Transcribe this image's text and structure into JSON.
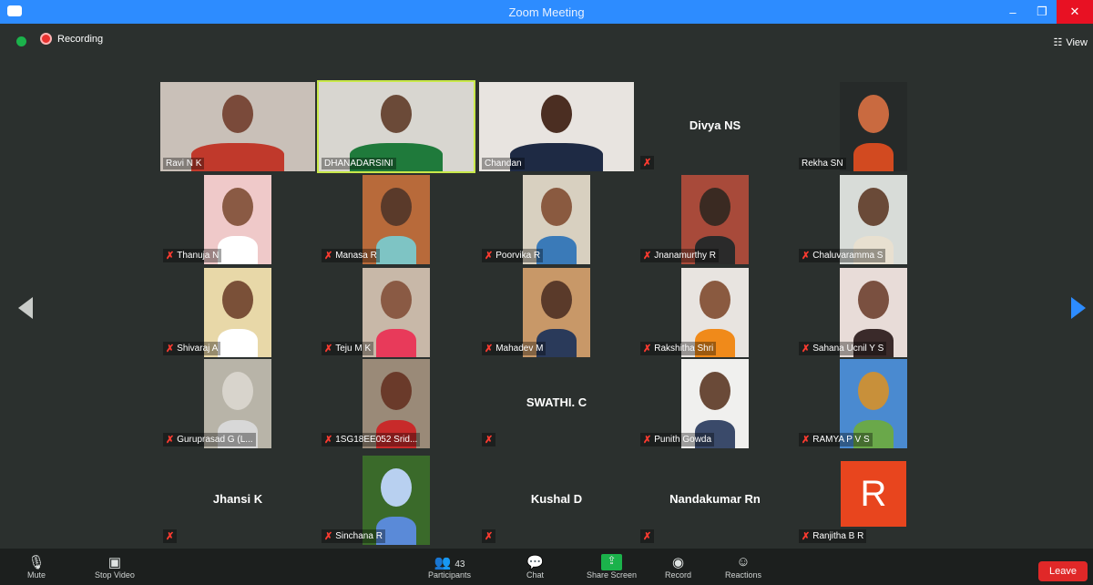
{
  "window": {
    "title": "Zoom Meeting"
  },
  "meeting": {
    "recording_label": "Recording",
    "view_label": "View"
  },
  "participants": [
    {
      "name": "Ravi N K",
      "display": "video",
      "muted": false,
      "bg": "#c9c0b8",
      "skin": "#7a4a3a",
      "shirt": "#c0392b"
    },
    {
      "name": "DHANADARSINI",
      "display": "video",
      "muted": false,
      "bg": "#d8d6d0",
      "skin": "#6b4a38",
      "shirt": "#1f7a3b",
      "active": true
    },
    {
      "name": "Chandan",
      "display": "video",
      "muted": false,
      "bg": "#e8e4e0",
      "skin": "#4b2e22",
      "shirt": "#1e2a44"
    },
    {
      "name": "Divya NS",
      "display": "name",
      "muted": true
    },
    {
      "name": "Rekha SN",
      "display": "video",
      "muted": false,
      "bg": "#262a29",
      "skin": "#c96a40",
      "shirt": "#d24a20"
    },
    {
      "name": "Thanuja N",
      "display": "video",
      "muted": true,
      "bg": "#efc9c9",
      "skin": "#8a5a44",
      "shirt": "#ffffff"
    },
    {
      "name": "Manasa R",
      "display": "video",
      "muted": true,
      "bg": "#b86a3a",
      "skin": "#5a3a2a",
      "shirt": "#7ec4c4"
    },
    {
      "name": "Poorvika R",
      "display": "video",
      "muted": true,
      "bg": "#d8d0c0",
      "skin": "#8a5a40",
      "shirt": "#3a7ab8"
    },
    {
      "name": "Jnanamurthy R",
      "display": "video",
      "muted": true,
      "bg": "#a84a3a",
      "skin": "#3a2a22",
      "shirt": "#2a2a2a"
    },
    {
      "name": "Chaluvaramma S",
      "display": "video",
      "muted": true,
      "bg": "#d8dcd8",
      "skin": "#6a4a38",
      "shirt": "#e8e0d0"
    },
    {
      "name": "Shivaraj A",
      "display": "video",
      "muted": true,
      "bg": "#e8d8a8",
      "skin": "#7a5038",
      "shirt": "#ffffff"
    },
    {
      "name": "Teju M K",
      "display": "video",
      "muted": true,
      "bg": "#c8b8a8",
      "skin": "#8a5a44",
      "shirt": "#e83a5a"
    },
    {
      "name": "Mahadev M",
      "display": "video",
      "muted": true,
      "bg": "#c89868",
      "skin": "#5a3a2a",
      "shirt": "#2a3a5a"
    },
    {
      "name": "Rakshitha Shri",
      "display": "video",
      "muted": true,
      "bg": "#e8e4e0",
      "skin": "#8a5a40",
      "shirt": "#f08a1a"
    },
    {
      "name": "Sahana Ucnil Y S",
      "display": "video",
      "muted": true,
      "bg": "#e8dcd8",
      "skin": "#7a5040",
      "shirt": "#3a2a2a"
    },
    {
      "name": "Guruprasad G (L...",
      "display": "video",
      "muted": true,
      "bg": "#b8b4a8",
      "skin": "#d8d4cc",
      "shirt": "#d8d8d8"
    },
    {
      "name": "1SG18EE052 Srid...",
      "display": "video",
      "muted": true,
      "bg": "#9a8a78",
      "skin": "#6a3a2a",
      "shirt": "#c82a2a"
    },
    {
      "name": "SWATHI. C",
      "display": "name",
      "muted": true
    },
    {
      "name": "Punith Gowda",
      "display": "video",
      "muted": true,
      "bg": "#f0f0ee",
      "skin": "#6a4a38",
      "shirt": "#3a4a6a"
    },
    {
      "name": "RAMYA P V S",
      "display": "video",
      "muted": true,
      "bg": "#4a8ad0",
      "skin": "#c8903a",
      "shirt": "#6aa84a"
    },
    {
      "name": "Jhansi K",
      "display": "name",
      "muted": true
    },
    {
      "name": "Sinchana R",
      "display": "video",
      "muted": true,
      "bg": "#3a6a2a",
      "skin": "#b8d0f0",
      "shirt": "#5a8ad8"
    },
    {
      "name": "Kushal D",
      "display": "name",
      "muted": true
    },
    {
      "name": "Nandakumar Rn",
      "display": "name",
      "muted": true
    },
    {
      "name": "Ranjitha B R",
      "display": "avatar",
      "initial": "R",
      "muted": true
    }
  ],
  "toolbar": {
    "mute_label": "Mute",
    "stop_video_label": "Stop Video",
    "participants_label": "Participants",
    "participants_count": "43",
    "chat_label": "Chat",
    "share_label": "Share Screen",
    "record_label": "Record",
    "reactions_label": "Reactions",
    "leave_label": "Leave"
  },
  "colors": {
    "accent": "#2d8cff",
    "leave": "#e02828",
    "muted": "#ff3b30",
    "active_speaker": "#c8e84a"
  }
}
